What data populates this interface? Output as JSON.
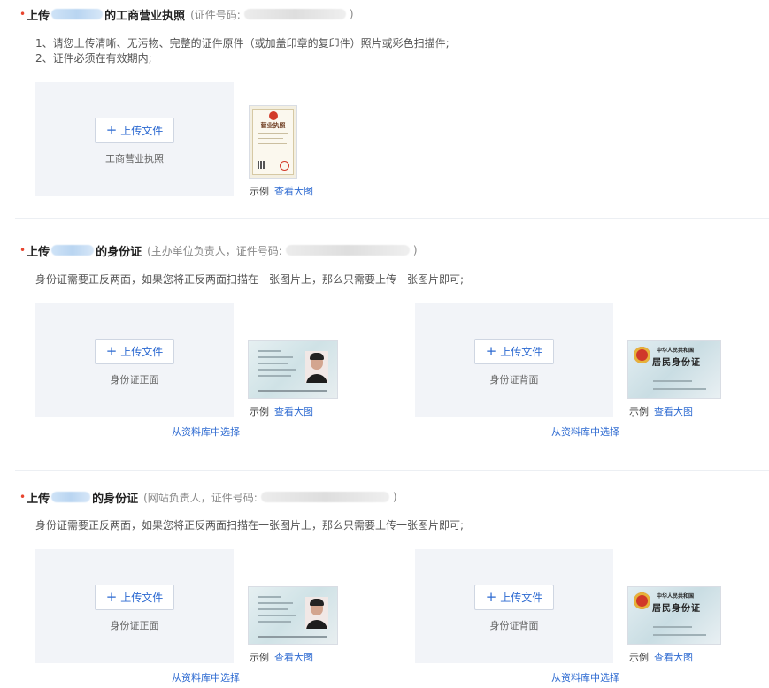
{
  "sections": {
    "license": {
      "required_mark": "•",
      "title_prefix": "上传",
      "title_suffix": "的工商营业执照",
      "note_prefix": "(证件号码:",
      "note_suffix": ")",
      "tips": [
        "1、请您上传清晰、无污物、完整的证件原件（或加盖印章的复印件）照片或彩色扫描件;",
        "2、证件必须在有效期内;"
      ],
      "upload_label": "上传文件",
      "upload_caption": "工商营业执照",
      "sample_label": "示例",
      "sample_link": "查看大图",
      "thumb_title": "营业执照"
    },
    "sponsor_id": {
      "required_mark": "•",
      "title_prefix": "上传",
      "title_suffix": "的身份证",
      "note_prefix": "(主办单位负责人，证件号码:",
      "note_suffix": ")",
      "tip": "身份证需要正反两面，如果您将正反两面扫描在一张图片上，那么只需要上传一张图片即可;",
      "front_upload_label": "上传文件",
      "front_caption": "身份证正面",
      "back_upload_label": "上传文件",
      "back_caption": "身份证背面",
      "sample_label": "示例",
      "sample_link": "查看大图",
      "library_link": "从资料库中选择"
    },
    "site_id": {
      "required_mark": "•",
      "title_prefix": "上传",
      "title_suffix": "的身份证",
      "note_prefix": "(网站负责人，证件号码:",
      "note_suffix": ")",
      "tip": "身份证需要正反两面，如果您将正反两面扫描在一张图片上，那么只需要上传一张图片即可;",
      "front_upload_label": "上传文件",
      "front_caption": "身份证正面",
      "back_upload_label": "上传文件",
      "back_caption": "身份证背面",
      "sample_label": "示例",
      "sample_link": "查看大图",
      "library_link": "从资料库中选择"
    }
  },
  "id_back": {
    "country": "中华人民共和国",
    "card_name": "居民身份证"
  },
  "icons": {
    "plus": "+"
  },
  "colors": {
    "accent": "#2d6ad1",
    "required": "#e8452f",
    "upload_bg": "#f2f4f8"
  }
}
